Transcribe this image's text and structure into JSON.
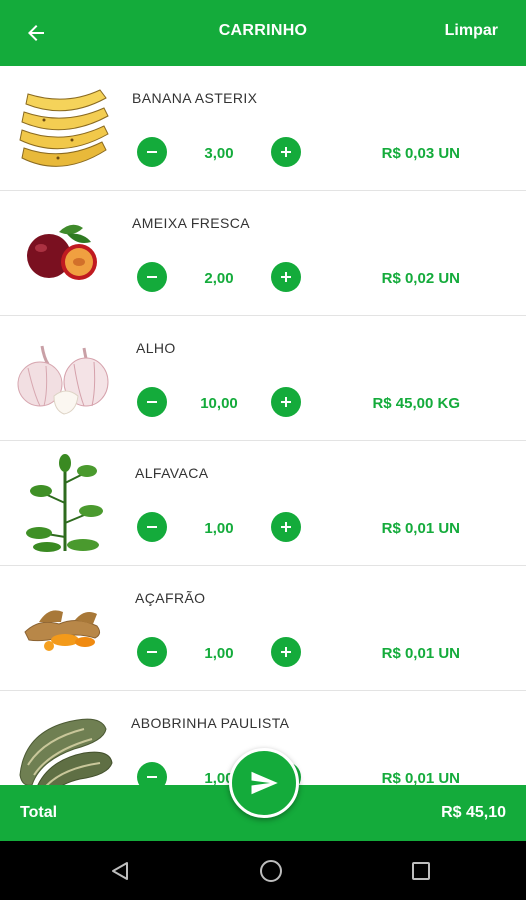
{
  "header": {
    "title": "CARRINHO",
    "clear_label": "Limpar",
    "back_icon": "arrow-left-icon"
  },
  "items": [
    {
      "name": "BANANA ASTERIX",
      "quantity": "3,00",
      "price": "R$ 0,03 UN",
      "image": "banana"
    },
    {
      "name": "AMEIXA FRESCA",
      "quantity": "2,00",
      "price": "R$ 0,02 UN",
      "image": "plum"
    },
    {
      "name": "ALHO",
      "quantity": "10,00",
      "price": "R$ 45,00 KG",
      "image": "garlic"
    },
    {
      "name": "ALFAVACA",
      "quantity": "1,00",
      "price": "R$ 0,01 UN",
      "image": "basil"
    },
    {
      "name": "AÇAFRÃO",
      "quantity": "1,00",
      "price": "R$ 0,01 UN",
      "image": "turmeric"
    },
    {
      "name": "ABOBRINHA PAULISTA",
      "quantity": "1,00",
      "price": "R$ 0,01 UN",
      "image": "zucchini"
    }
  ],
  "footer": {
    "total_label": "Total",
    "total_value": "R$ 45,10",
    "send_icon": "send-icon"
  },
  "colors": {
    "primary": "#14ab3b",
    "nav_bar": "#000000",
    "divider": "#e3e3e3"
  },
  "system_nav": {
    "back_icon": "nav-back-icon",
    "home_icon": "nav-home-icon",
    "recents_icon": "nav-recents-icon"
  }
}
